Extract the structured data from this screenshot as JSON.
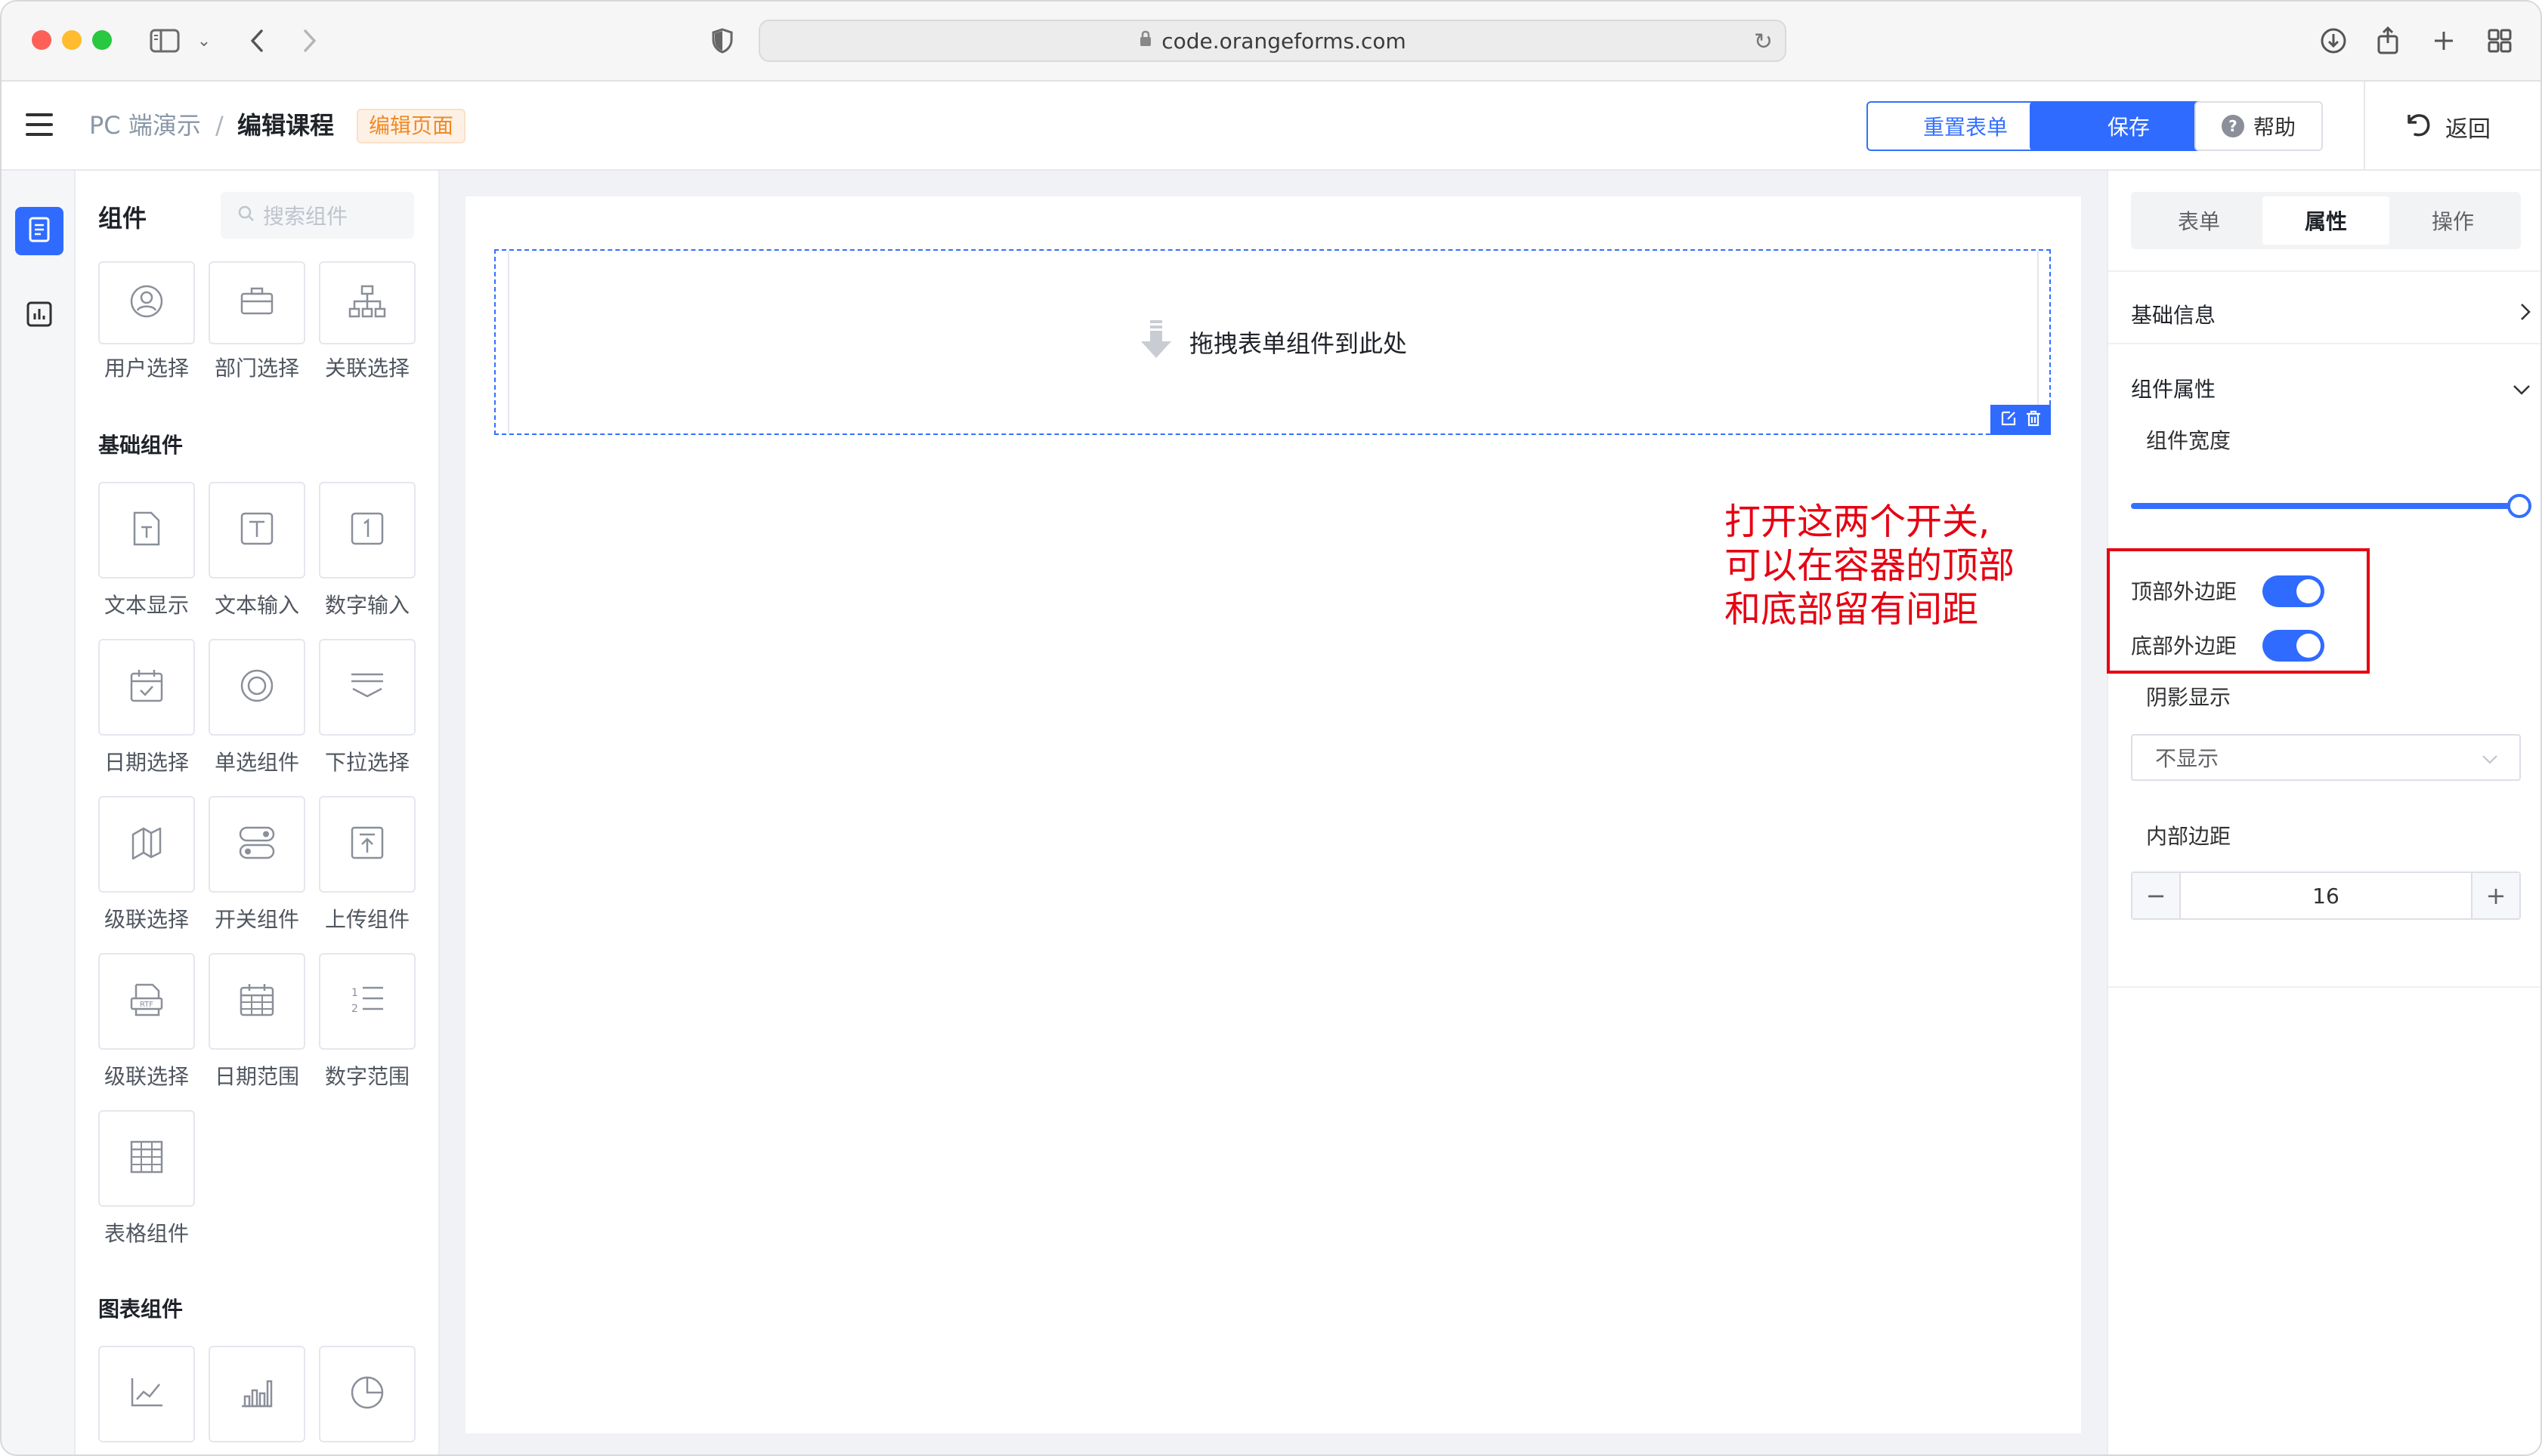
{
  "browser": {
    "url": "code.orangeforms.com"
  },
  "header": {
    "breadcrumb_root": "PC 端演示",
    "breadcrumb_sep": "/",
    "breadcrumb_current": "编辑课程",
    "mode_tag": "编辑页面",
    "reset_label": "重置表单",
    "save_label": "保存",
    "help_label": "帮助",
    "help_icon_char": "?",
    "back_label": "返回"
  },
  "panel": {
    "title": "组件",
    "search_placeholder": "搜索组件",
    "top_items": [
      {
        "label": "用户选择",
        "icon": "user-icon"
      },
      {
        "label": "部门选择",
        "icon": "briefcase-icon"
      },
      {
        "label": "关联选择",
        "icon": "org-chart-icon"
      }
    ],
    "basic_title": "基础组件",
    "basic_items": [
      {
        "label": "文本显示",
        "icon": "text-file-icon"
      },
      {
        "label": "文本输入",
        "icon": "text-input-icon"
      },
      {
        "label": "数字输入",
        "icon": "number-input-icon"
      },
      {
        "label": "日期选择",
        "icon": "calendar-icon"
      },
      {
        "label": "单选组件",
        "icon": "radio-icon"
      },
      {
        "label": "下拉选择",
        "icon": "dropdown-icon"
      },
      {
        "label": "级联选择",
        "icon": "cascade-map-icon"
      },
      {
        "label": "开关组件",
        "icon": "switch-icon"
      },
      {
        "label": "上传组件",
        "icon": "upload-icon"
      },
      {
        "label": "级联选择",
        "icon": "rtf-icon"
      },
      {
        "label": "日期范围",
        "icon": "date-range-icon"
      },
      {
        "label": "数字范围",
        "icon": "number-list-icon"
      },
      {
        "label": "表格组件",
        "icon": "table-icon"
      }
    ],
    "chart_title": "图表组件",
    "chart_items": [
      {
        "icon": "line-chart-icon"
      },
      {
        "icon": "bar-chart-icon"
      },
      {
        "icon": "pie-chart-icon"
      }
    ]
  },
  "canvas": {
    "drop_hint": "拖拽表单组件到此处",
    "annotation_line1": "打开这两个开关,",
    "annotation_line2": "可以在容器的顶部",
    "annotation_line3": "和底部留有间距",
    "annotation_color": "#e60012"
  },
  "props": {
    "tabs": [
      "表单",
      "属性",
      "操作"
    ],
    "active_tab": "属性",
    "basic_info": "基础信息",
    "component_props": "组件属性",
    "width_label": "组件宽度",
    "width_value_fraction": 1.0,
    "top_margin_label": "顶部外边距",
    "top_margin_on": true,
    "bottom_margin_label": "底部外边距",
    "bottom_margin_on": true,
    "shadow_label": "阴影显示",
    "shadow_value": "不显示",
    "padding_label": "内部边距",
    "padding_value": "16"
  },
  "colors": {
    "primary": "#2f6bff",
    "accent_orange": "#f08a24",
    "annotation_red": "#e60012"
  }
}
